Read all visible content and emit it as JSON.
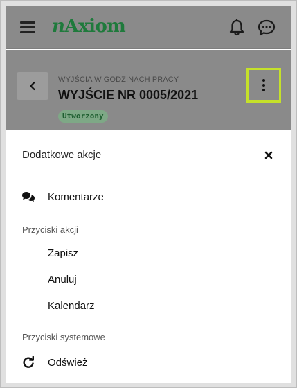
{
  "app": {
    "logo_n": "n",
    "logo_rest": "Axiom"
  },
  "document": {
    "subtitle": "WYJŚCIA W GODZINACH PRACY",
    "title": "WYJŚCIE NR 0005/2021",
    "status": "Utworzony"
  },
  "sheet": {
    "title": "Dodatkowe akcje",
    "comments_label": "Komentarze",
    "action_section": "Przyciski akcji",
    "actions": [
      "Zapisz",
      "Anuluj",
      "Kalendarz"
    ],
    "system_section": "Przyciski systemowe",
    "refresh_label": "Odśwież"
  },
  "colors": {
    "accent": "#1f7a3c",
    "highlight": "#c5e12a",
    "overlay": "#8a8a8a"
  },
  "icons": [
    "menu-icon",
    "bell-icon",
    "chat-icon",
    "chevron-left-icon",
    "more-vertical-icon",
    "close-icon",
    "comments-icon",
    "refresh-icon"
  ]
}
